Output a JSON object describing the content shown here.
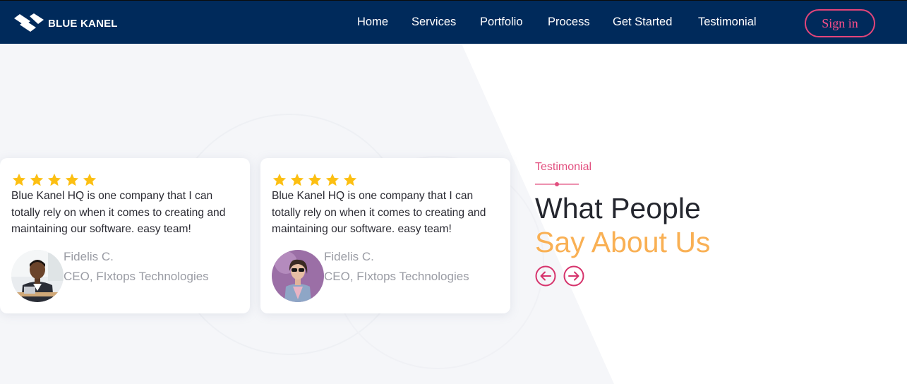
{
  "brand": {
    "name": "BLUE KANEL",
    "logo_icon": "blue-kanel-logo-icon"
  },
  "nav": {
    "items": [
      {
        "label": "Home"
      },
      {
        "label": "Services"
      },
      {
        "label": "Portfolio"
      },
      {
        "label": "Process"
      },
      {
        "label": "Get Started"
      },
      {
        "label": "Testimonial"
      }
    ],
    "signin_label": "Sign in"
  },
  "testimonial_section": {
    "eyebrow": "Testimonial",
    "heading_line1": "What People",
    "heading_line2": "Say About Us",
    "prev_icon": "arrow-left-circle-icon",
    "next_icon": "arrow-right-circle-icon"
  },
  "testimonials": [
    {
      "rating": 5,
      "quote": "Blue Kanel HQ is one company that I can totally rely on when it comes to creating and maintaining our software. easy team!",
      "name": "Fidelis C.",
      "title": "CEO, FIxtops Technologies",
      "avatar": "man-at-desk-avatar"
    },
    {
      "rating": 5,
      "quote": "Blue Kanel HQ is one company that I can totally rely on when it comes to creating and maintaining our software. easy team!",
      "name": "Fidelis C.",
      "title": "CEO, FIxtops Technologies",
      "avatar": "woman-with-sunglasses-avatar"
    }
  ],
  "colors": {
    "navbar": "#002a5b",
    "accent_pink": "#e24f7f",
    "accent_orange": "#f9b054",
    "star": "#fcbf12"
  }
}
